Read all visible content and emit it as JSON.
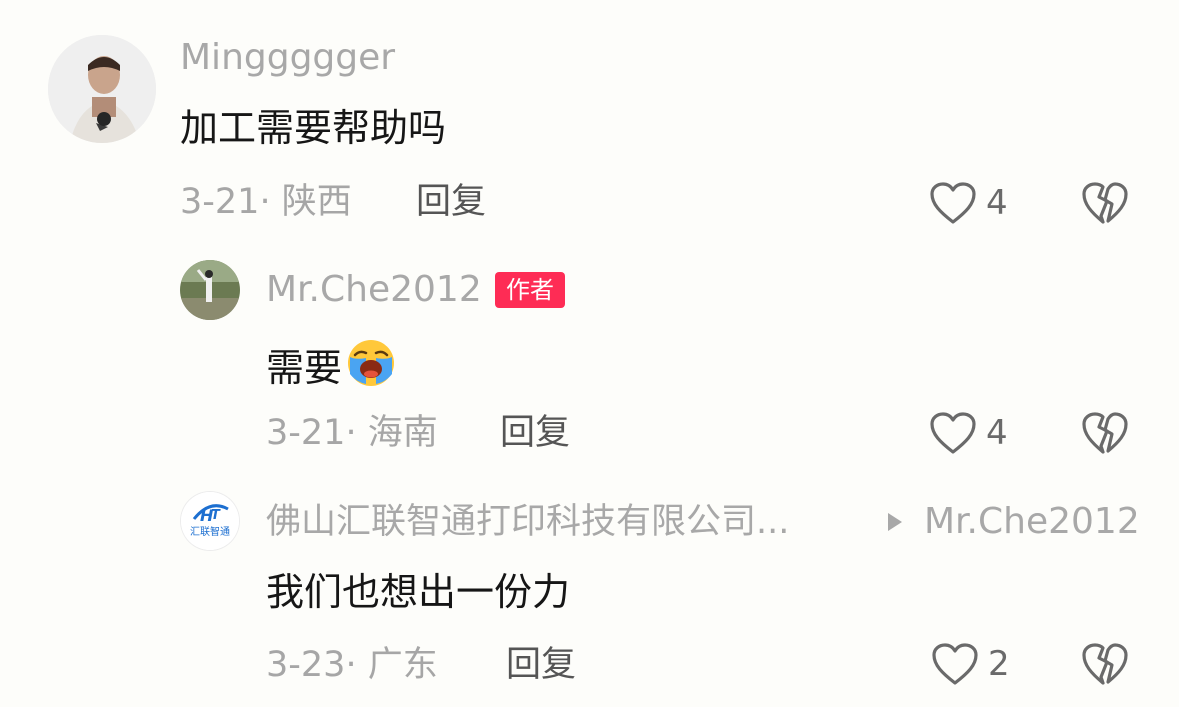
{
  "comments": [
    {
      "username": "Minggggger",
      "text": "加工需要帮助吗",
      "date": "3-21",
      "location": "陕西",
      "reply_label": "回复",
      "likes": "4"
    },
    {
      "username": "Mr.Che2012",
      "badge": "作者",
      "text": "需要",
      "emoji": "😭",
      "date": "3-21",
      "location": "海南",
      "reply_label": "回复",
      "likes": "4"
    },
    {
      "username": "佛山汇联智通打印科技有限公司...",
      "reply_to": "Mr.Che2012",
      "avatar_logo_text": "汇联智通",
      "text": "我们也想出一份力",
      "date": "3-23",
      "location": "广东",
      "reply_label": "回复",
      "likes": "2"
    }
  ],
  "colors": {
    "badge": "#fe2c55",
    "muted": "#a8a8a8",
    "text": "#161616"
  },
  "icons": [
    "heart-outline-icon",
    "broken-heart-icon",
    "play-arrow-icon"
  ]
}
